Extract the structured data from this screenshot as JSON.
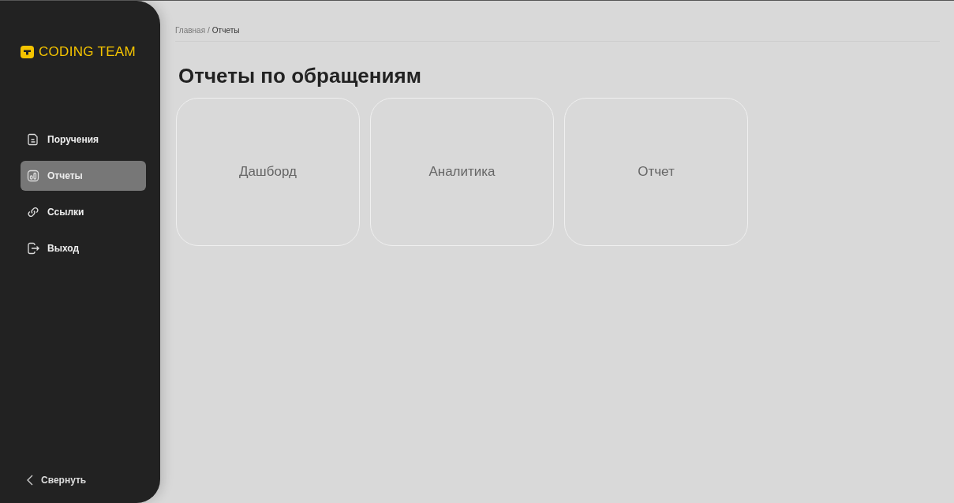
{
  "logo": {
    "text": "CODING TEAM"
  },
  "sidebar": {
    "items": [
      {
        "label": "Поручения",
        "kind": "document",
        "selected": false
      },
      {
        "label": "Отчеты",
        "kind": "chart",
        "selected": true
      },
      {
        "label": "Ссылки",
        "kind": "link",
        "selected": false
      },
      {
        "label": "Выход",
        "kind": "exit",
        "selected": false
      }
    ],
    "collapse": "Свернуть"
  },
  "breadcrumb": {
    "items": [
      {
        "label": "Главная",
        "current": false
      },
      {
        "label": "/",
        "current": false
      },
      {
        "label": "Отчеты",
        "current": true
      }
    ]
  },
  "title": "Отчеты по обращениям",
  "cards": [
    {
      "label": "Дашборд"
    },
    {
      "label": "Аналитика"
    },
    {
      "label": "Отчет"
    }
  ]
}
